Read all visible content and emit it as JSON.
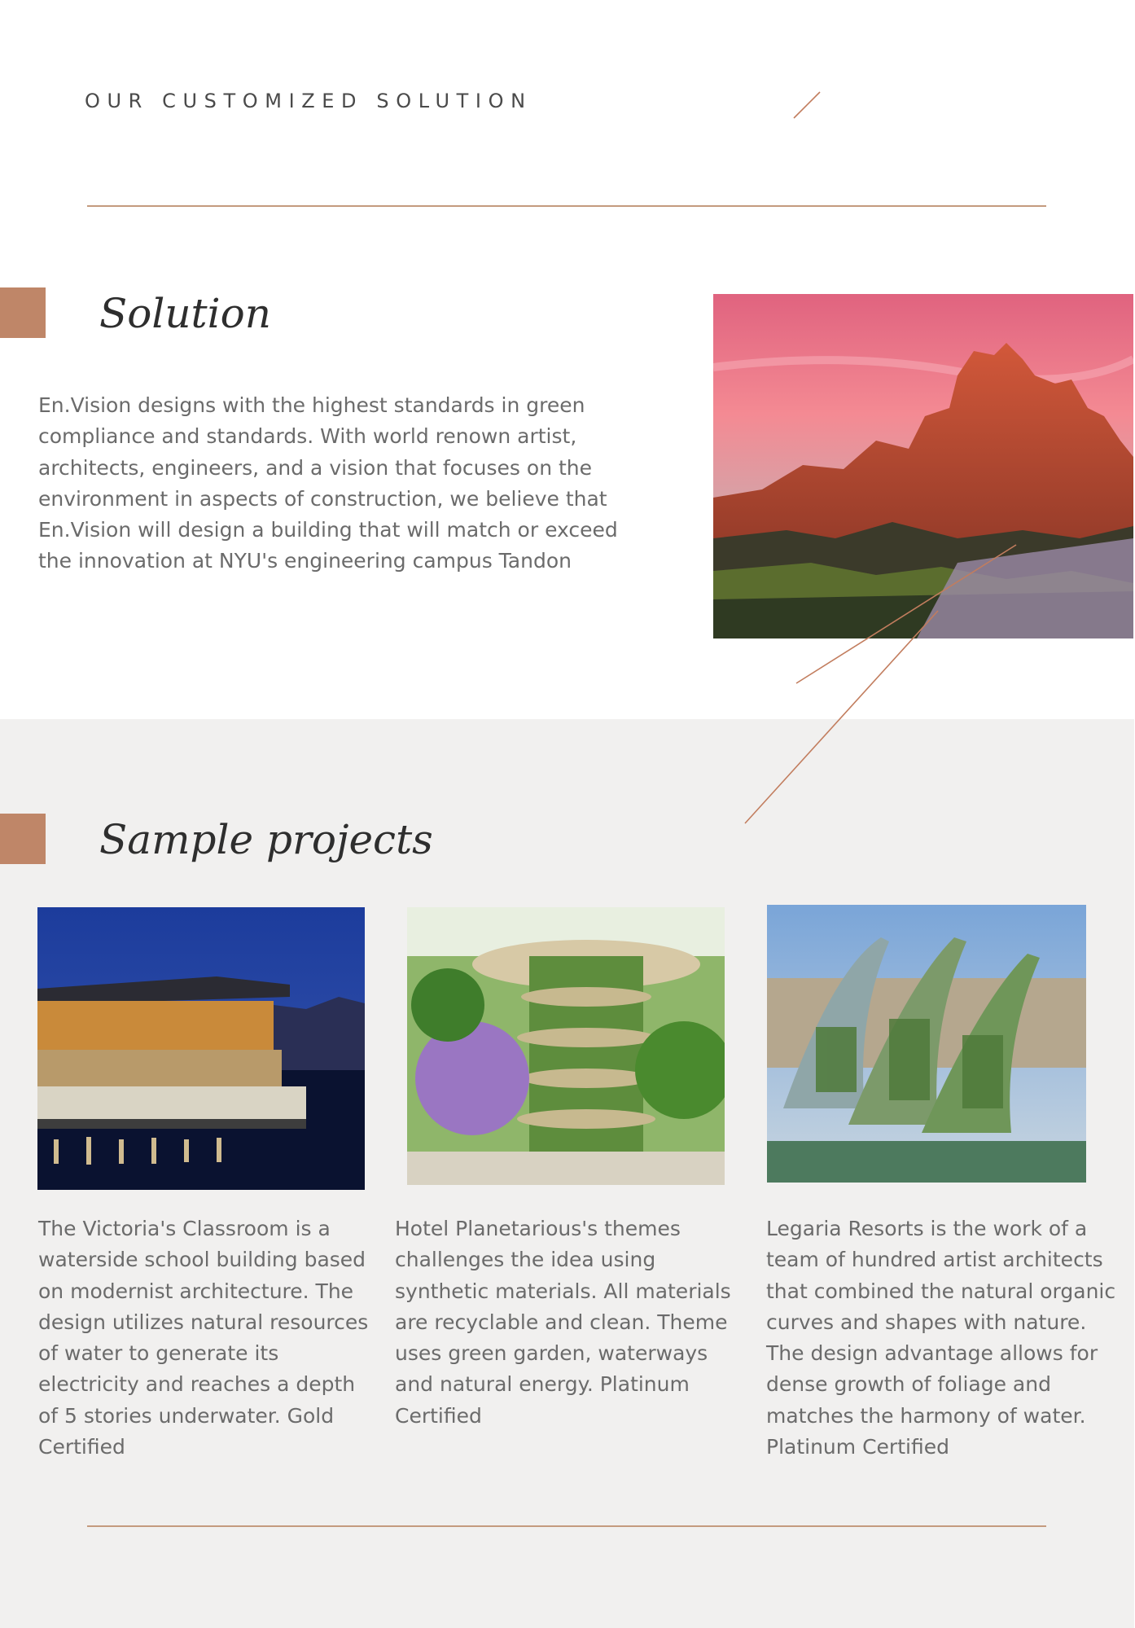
{
  "header": {
    "eyebrow": "OUR CUSTOMIZED SOLUTION"
  },
  "solution": {
    "heading": "Solution",
    "body": "En.Vision designs with the highest standards in green compliance and standards. With world renown artist, architects, engineers, and a vision that focuses on the environment in aspects of construction, we believe that En.Vision will design a building that will match or exceed the innovation at NYU's engineering campus Tandon",
    "image": {
      "icon": "mountain-landscape-photo"
    }
  },
  "sample_projects": {
    "heading": "Sample projects",
    "projects": [
      {
        "image": {
          "icon": "waterside-building-photo"
        },
        "description": "The Victoria's Classroom is a waterside school building based on modernist architecture. The design utilizes natural resources of water to generate its electricity and reaches a depth of 5 stories underwater. Gold Certified"
      },
      {
        "image": {
          "icon": "garden-tower-photo"
        },
        "description": "Hotel Planetarious's themes challenges the idea using synthetic materials. All materials are recyclable and clean. Theme uses green garden, waterways and natural energy. Platinum Certified"
      },
      {
        "image": {
          "icon": "wave-buildings-photo"
        },
        "description": "Legaria Resorts is the work of a team of hundred artist architects that combined the natural organic curves and shapes with nature. The design advantage allows for dense growth of foliage and matches the harmony of water. Platinum Certified"
      }
    ]
  },
  "colors": {
    "accent": "#bf8668",
    "rule": "#c49a7e",
    "band": "#f1f0ef",
    "heading": "#2e2e2e",
    "body": "#6b6b6b"
  }
}
